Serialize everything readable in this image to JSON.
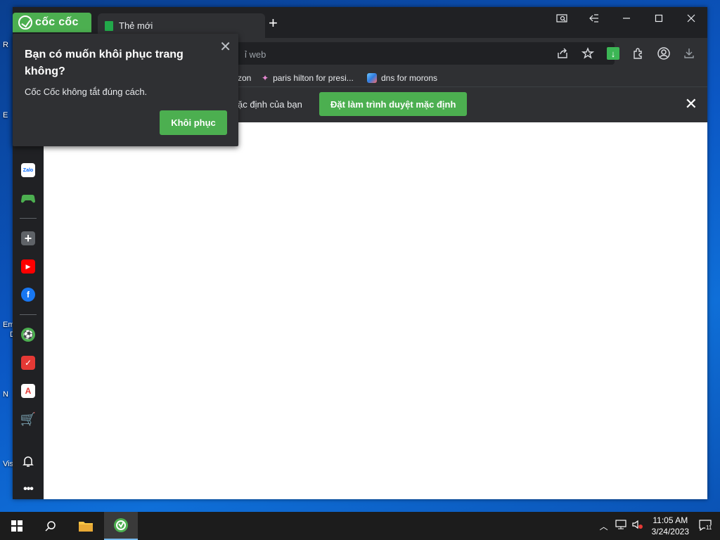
{
  "desktop": {
    "labels": [
      "R",
      "E",
      "E",
      "Em",
      "D",
      "N",
      "Vis"
    ]
  },
  "browser": {
    "brand": "cốc cốc",
    "tab": {
      "title": "Thẻ mới"
    },
    "new_tab_label": "+",
    "omnibox_placeholder": "ỉ web",
    "bookmarks": [
      {
        "label": "zon"
      },
      {
        "label": "paris hilton for presi..."
      },
      {
        "label": "dns for morons"
      }
    ],
    "infobar": {
      "text": "ặc định của bạn",
      "button": "Đặt làm trình duyệt mặc định"
    }
  },
  "popup": {
    "title": "Bạn có muốn khôi phục trang không?",
    "message": "Cốc Cốc không tắt đúng cách.",
    "button": "Khôi phục"
  },
  "taskbar": {
    "time": "11:05 AM",
    "date": "3/24/2023",
    "notification_count": "11"
  },
  "colors": {
    "accent": "#4caf50",
    "dark": "#202124",
    "toolbar": "#2f3033"
  }
}
